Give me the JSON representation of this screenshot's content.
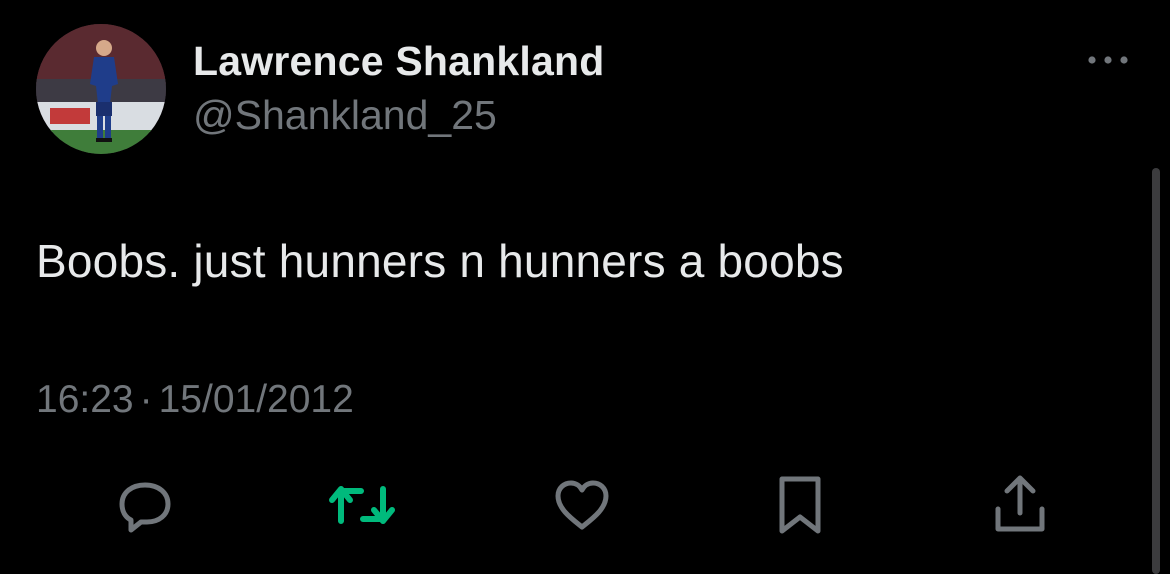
{
  "user": {
    "display_name": "Lawrence Shankland",
    "handle": "@Shankland_25",
    "avatar_icon": "footballer-photo-avatar"
  },
  "tweet": {
    "text": "Boobs. just hunners n hunners a boobs",
    "time": "16:23",
    "separator": "·",
    "date": "15/01/2012"
  },
  "actions": {
    "reply_icon": "reply-icon",
    "retweet_icon": "retweet-icon",
    "like_icon": "heart-icon",
    "bookmark_icon": "bookmark-icon",
    "share_icon": "share-icon",
    "more_icon": "more-options-icon"
  },
  "colors": {
    "background": "#000000",
    "primary_text": "#e7e9ea",
    "secondary_text": "#71767b",
    "retweet_active": "#00ba7c"
  }
}
